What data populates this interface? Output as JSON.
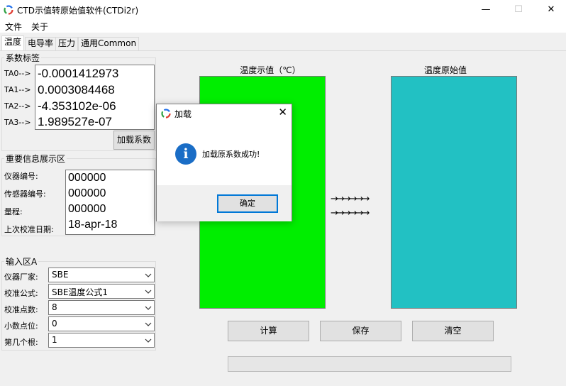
{
  "window": {
    "title": "CTD示值转原始值软件(CTDi2r)",
    "minimize_glyph": "—",
    "maximize_glyph": "☐",
    "close_glyph": "✕"
  },
  "menu": [
    "文件",
    "关于"
  ],
  "tabs": [
    "温度",
    "电导率",
    "压力",
    "通用Common"
  ],
  "coefficients": {
    "group_title": "系数标签",
    "items": [
      {
        "label": "TA0-->",
        "value": "-0.0001412973"
      },
      {
        "label": "TA1-->",
        "value": "0.0003084468"
      },
      {
        "label": "TA2-->",
        "value": "-4.353102e-06"
      },
      {
        "label": "TA3-->",
        "value": "1.989527e-07"
      }
    ],
    "load_button": "加载系数"
  },
  "info": {
    "group_title": "重要信息展示区",
    "labels": [
      "仪器编号:",
      "传感器编号:",
      "量程:",
      "上次校准日期:"
    ],
    "values": [
      "000000",
      "000000",
      "000000",
      "18-apr-18"
    ]
  },
  "input": {
    "group_title": "输入区A",
    "rows": [
      {
        "label": "仪器厂家:",
        "value": "SBE"
      },
      {
        "label": "校准公式:",
        "value": "SBE温度公式1"
      },
      {
        "label": "校准点数:",
        "value": "8"
      },
      {
        "label": "小数点位:",
        "value": "0"
      },
      {
        "label": "第几个根:",
        "value": "1"
      }
    ]
  },
  "panels": {
    "left_title": "温度示值（℃）",
    "right_title": "温度原始值",
    "left_color": "#00ee00",
    "right_color": "#22c1c3",
    "arrow_row": "→→→→→→"
  },
  "actions": {
    "calculate": "计算",
    "save": "保存",
    "clear": "清空"
  },
  "progress_fraction": 0,
  "dialog": {
    "title": "加载",
    "message": "加载原系数成功!",
    "ok": "确定",
    "icon_glyph": "i",
    "close_glyph": "✕"
  }
}
